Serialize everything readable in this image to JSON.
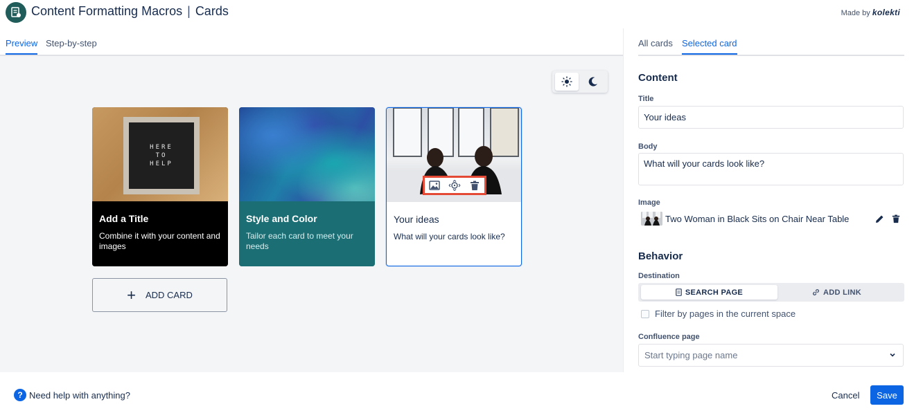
{
  "header": {
    "title": "Content Formatting Macros",
    "subtitle": "Cards",
    "made_by_label": "Made by",
    "brand": "kolekti",
    "logo_icon": "macro-document-icon"
  },
  "left_tabs": [
    "Preview",
    "Step-by-step"
  ],
  "theme_toggle": {
    "light_icon": "sun-icon",
    "dark_icon": "moon-icon",
    "selected": "light"
  },
  "cards": [
    {
      "title": "Add a Title",
      "text": "Combine it with your content and images",
      "image_text": [
        "HERE",
        "TO",
        "HELP"
      ],
      "color": "#000000"
    },
    {
      "title": "Style and Color",
      "text": "Tailor each card to meet your needs",
      "color": "#1b6f74"
    },
    {
      "title": "Your ideas",
      "text": "What will your cards look like?",
      "selected": true,
      "image_toolbar": [
        "image-icon",
        "focus-point-icon",
        "trash-icon"
      ]
    }
  ],
  "add_card_label": "ADD CARD",
  "right_tabs": [
    "All cards",
    "Selected card"
  ],
  "content": {
    "heading": "Content",
    "title_label": "Title",
    "title_value": "Your ideas",
    "body_label": "Body",
    "body_value": "What will your cards look like?",
    "image_label": "Image",
    "image_name": "Two Woman in Black Sits on Chair Near Table"
  },
  "behavior": {
    "heading": "Behavior",
    "destination_label": "Destination",
    "search_page": "SEARCH PAGE",
    "add_link": "ADD LINK",
    "filter_label": "Filter by pages in the current space",
    "confluence_label": "Confluence page",
    "confluence_placeholder": "Start typing page name"
  },
  "footer": {
    "help": "Need help with anything?",
    "cancel": "Cancel",
    "save": "Save"
  },
  "colors": {
    "accent": "#0c66e4",
    "teal": "#1b6f74",
    "highlight": "#e34935"
  }
}
